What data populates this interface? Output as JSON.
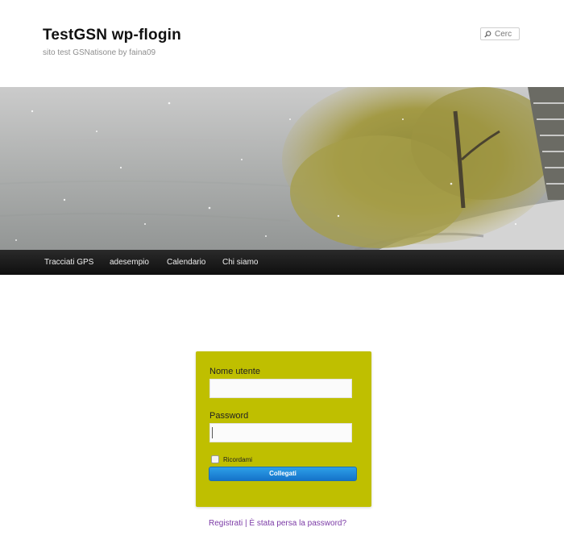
{
  "header": {
    "site_title": "TestGSN  wp-flogin",
    "tagline": "sito test GSNatisone by faina09",
    "search": {
      "placeholder": "Cerc"
    }
  },
  "nav": {
    "items": [
      {
        "label": "Tracciati GPS"
      },
      {
        "label": "adesempio"
      },
      {
        "label": "Calendario"
      },
      {
        "label": "Chi siamo"
      }
    ]
  },
  "login": {
    "username_label": "Nome utente",
    "username_value": "",
    "password_label": "Password",
    "password_value": "",
    "remember_label": "Ricordami",
    "remember_checked": false,
    "submit_label": "Collegati",
    "box_color": "#bfbf00",
    "button_color": "#1e86d6"
  },
  "links": {
    "register": "Registrati",
    "separator": " | ",
    "lost_password": "È stata persa la password?",
    "color": "#7b3aa6"
  }
}
